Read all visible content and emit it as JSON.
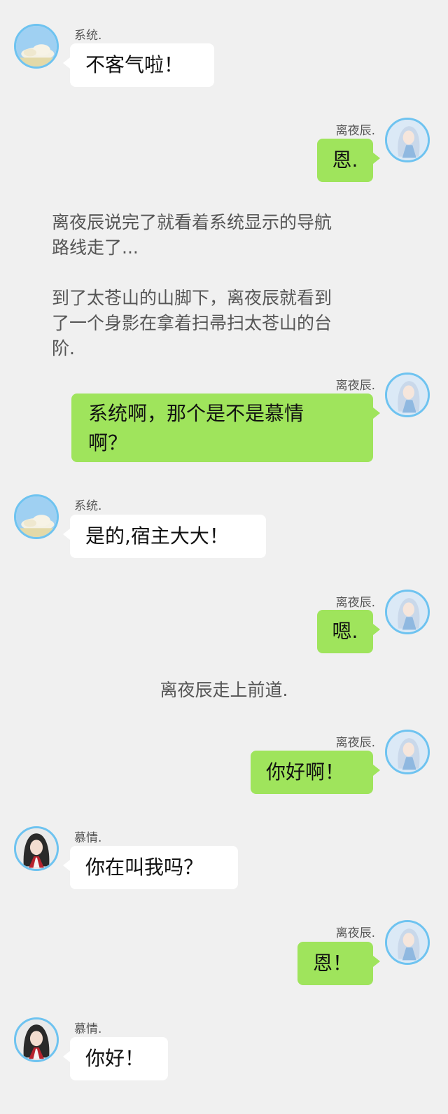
{
  "colors": {
    "background": "#f0f0f0",
    "incoming_bubble": "#ffffff",
    "outgoing_bubble": "#9fe45c",
    "avatar_ring": "#6ec3f0"
  },
  "messages": [
    {
      "type": "incoming",
      "sender": "系统.",
      "avatar": "sky-cloud-avatar",
      "text": "不客气啦！"
    },
    {
      "type": "outgoing",
      "sender": "离夜辰.",
      "avatar": "silver-hair-character-avatar",
      "text": "恩."
    },
    {
      "type": "narration",
      "lines": [
        "离夜辰说完了就看着系统显示的导航",
        "路线走了...",
        "",
        "到了太苍山的山脚下，离夜辰就看到",
        "了一个身影在拿着扫帚扫太苍山的台",
        "阶."
      ]
    },
    {
      "type": "outgoing",
      "sender": "离夜辰.",
      "avatar": "silver-hair-character-avatar",
      "lines": [
        "系统啊，那个是不是慕情",
        "啊？"
      ]
    },
    {
      "type": "incoming",
      "sender": "系统.",
      "avatar": "sky-cloud-avatar",
      "text": "是的,宿主大大！"
    },
    {
      "type": "outgoing",
      "sender": "离夜辰.",
      "avatar": "silver-hair-character-avatar",
      "text": "嗯."
    },
    {
      "type": "narration",
      "text": "离夜辰走上前道."
    },
    {
      "type": "outgoing",
      "sender": "离夜辰.",
      "avatar": "silver-hair-character-avatar",
      "text": "你好啊！"
    },
    {
      "type": "incoming",
      "sender": "慕情.",
      "avatar": "dark-hair-character-avatar",
      "text": "你在叫我吗？"
    },
    {
      "type": "outgoing",
      "sender": "离夜辰.",
      "avatar": "silver-hair-character-avatar",
      "text": "恩！"
    },
    {
      "type": "incoming",
      "sender": "慕情.",
      "avatar": "dark-hair-character-avatar",
      "text": "你好！"
    }
  ]
}
